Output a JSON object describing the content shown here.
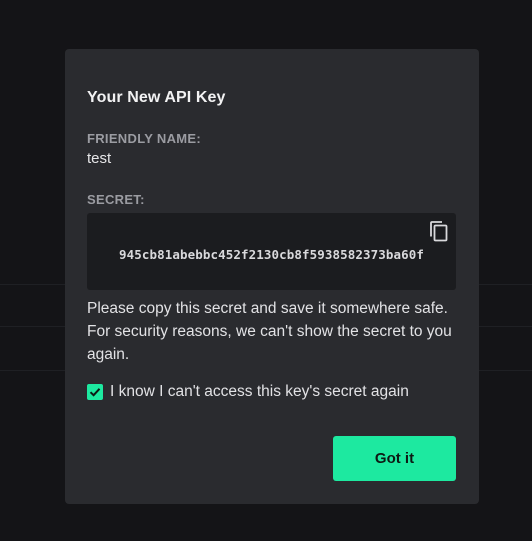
{
  "modal": {
    "title": "Your New API Key",
    "friendly_name_label": "FRIENDLY NAME:",
    "friendly_name_value": "test",
    "secret_label": "SECRET:",
    "secret_value": "945cb81abebbc452f2130cb8f5938582373ba60f",
    "copy_icon": "copy-icon",
    "notice": "Please copy this secret and save it somewhere safe. For security reasons, we can't show the secret to you again.",
    "checkbox_label": "I know I can't access this key's secret again",
    "checkbox_checked": true,
    "confirm_label": "Got it"
  },
  "colors": {
    "accent": "#1de9a0",
    "modal_bg": "#2a2b2f",
    "page_bg": "#141417",
    "secret_bg": "#1b1c1f"
  }
}
